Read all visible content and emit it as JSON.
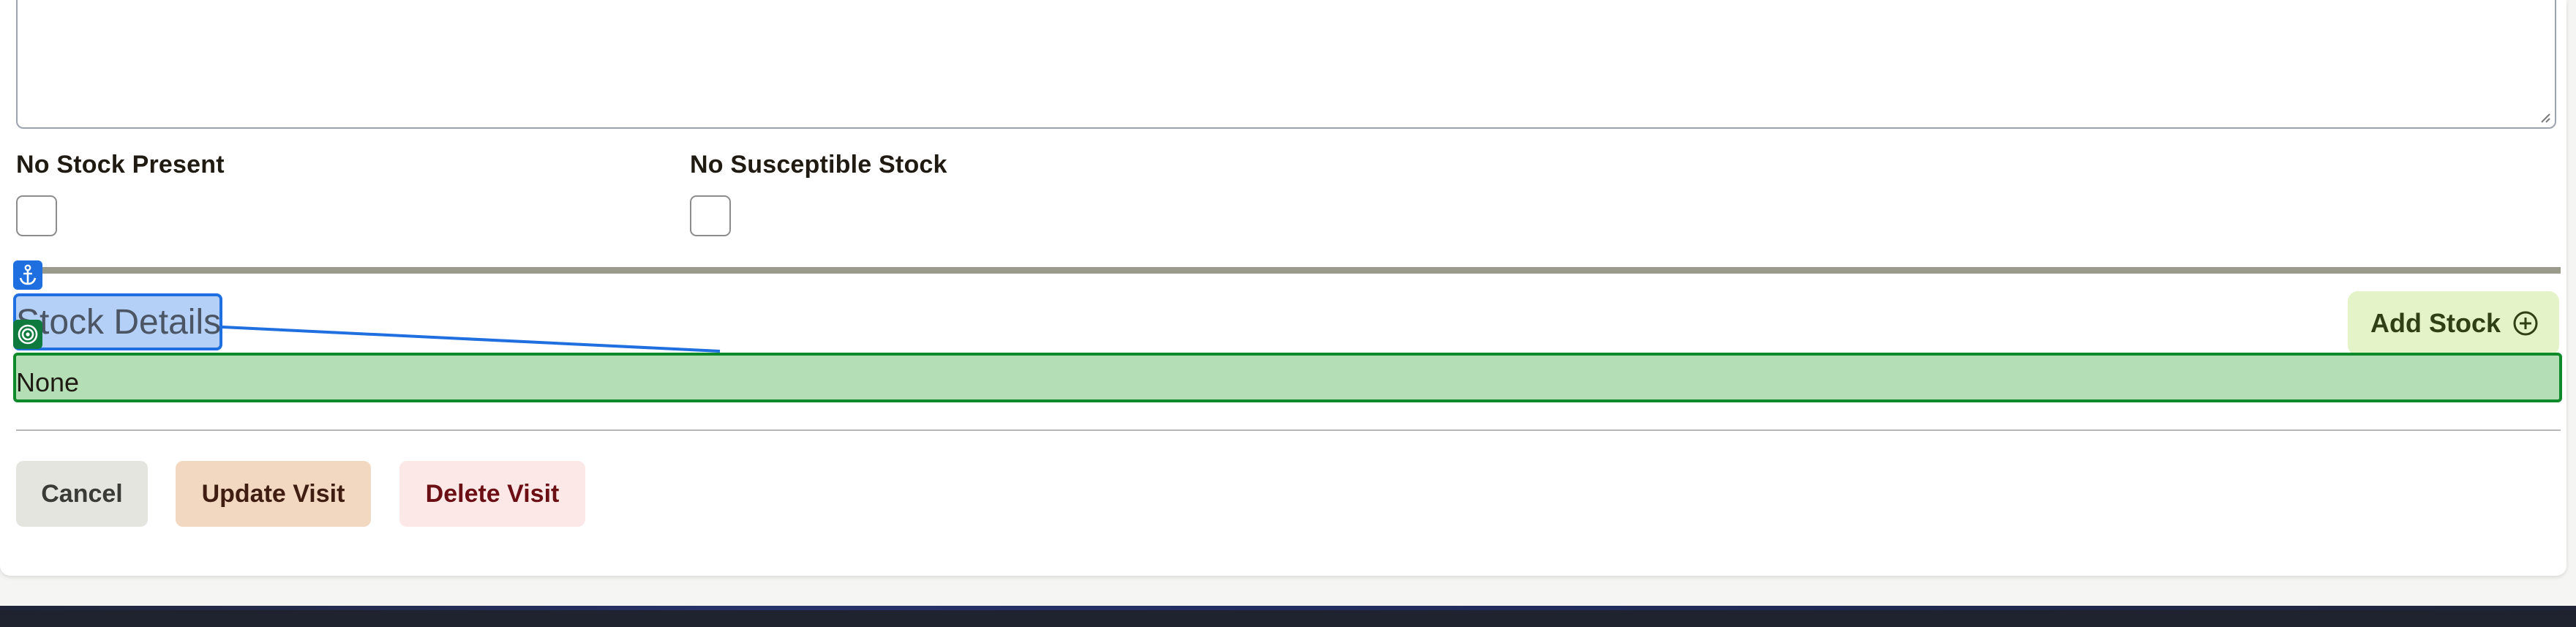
{
  "form": {
    "no_stock_present_label": "No Stock Present",
    "no_stock_present_checked": false,
    "no_susceptible_stock_label": "No Susceptible Stock",
    "no_susceptible_stock_checked": false
  },
  "stock_section": {
    "heading": "Stock Details",
    "add_button_label": "Add Stock",
    "add_button_icon": "plus-circle-icon",
    "empty_text": "None"
  },
  "overlay": {
    "anchor_icon": "anchor-icon",
    "target_icon": "target-icon",
    "anchor_color": "#1f6fe0",
    "target_color": "#0f8a2b"
  },
  "actions": {
    "cancel_label": "Cancel",
    "update_label": "Update Visit",
    "delete_label": "Delete Visit"
  },
  "colors": {
    "add_stock_bg": "#e5f4c8",
    "update_bg": "#f2d7c1",
    "delete_bg": "#fde8e8",
    "cancel_bg": "#e5e5e0"
  }
}
